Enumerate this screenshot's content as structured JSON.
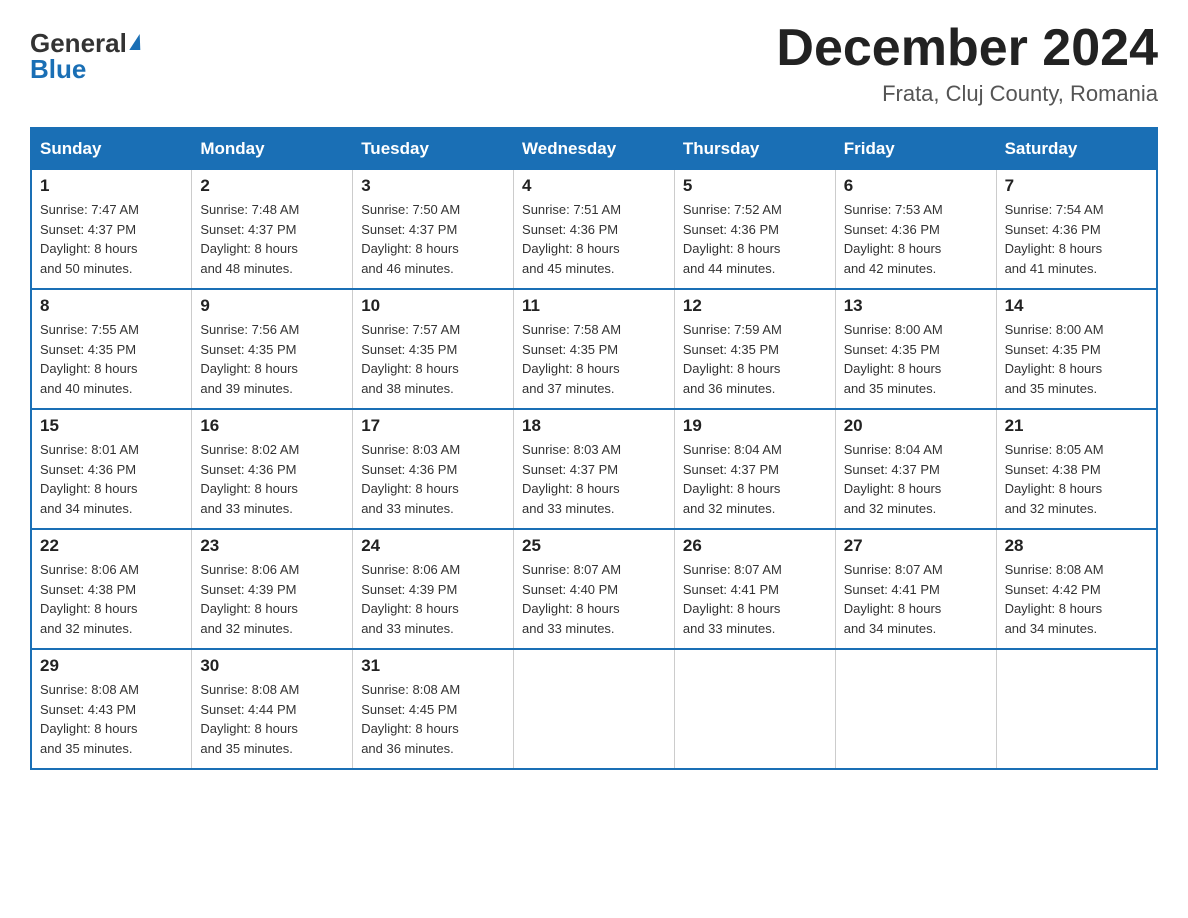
{
  "header": {
    "logo_general": "General",
    "logo_blue": "Blue",
    "month_title": "December 2024",
    "location": "Frata, Cluj County, Romania"
  },
  "days_of_week": [
    "Sunday",
    "Monday",
    "Tuesday",
    "Wednesday",
    "Thursday",
    "Friday",
    "Saturday"
  ],
  "weeks": [
    [
      {
        "day": "1",
        "sunrise": "7:47 AM",
        "sunset": "4:37 PM",
        "daylight": "8 hours and 50 minutes."
      },
      {
        "day": "2",
        "sunrise": "7:48 AM",
        "sunset": "4:37 PM",
        "daylight": "8 hours and 48 minutes."
      },
      {
        "day": "3",
        "sunrise": "7:50 AM",
        "sunset": "4:37 PM",
        "daylight": "8 hours and 46 minutes."
      },
      {
        "day": "4",
        "sunrise": "7:51 AM",
        "sunset": "4:36 PM",
        "daylight": "8 hours and 45 minutes."
      },
      {
        "day": "5",
        "sunrise": "7:52 AM",
        "sunset": "4:36 PM",
        "daylight": "8 hours and 44 minutes."
      },
      {
        "day": "6",
        "sunrise": "7:53 AM",
        "sunset": "4:36 PM",
        "daylight": "8 hours and 42 minutes."
      },
      {
        "day": "7",
        "sunrise": "7:54 AM",
        "sunset": "4:36 PM",
        "daylight": "8 hours and 41 minutes."
      }
    ],
    [
      {
        "day": "8",
        "sunrise": "7:55 AM",
        "sunset": "4:35 PM",
        "daylight": "8 hours and 40 minutes."
      },
      {
        "day": "9",
        "sunrise": "7:56 AM",
        "sunset": "4:35 PM",
        "daylight": "8 hours and 39 minutes."
      },
      {
        "day": "10",
        "sunrise": "7:57 AM",
        "sunset": "4:35 PM",
        "daylight": "8 hours and 38 minutes."
      },
      {
        "day": "11",
        "sunrise": "7:58 AM",
        "sunset": "4:35 PM",
        "daylight": "8 hours and 37 minutes."
      },
      {
        "day": "12",
        "sunrise": "7:59 AM",
        "sunset": "4:35 PM",
        "daylight": "8 hours and 36 minutes."
      },
      {
        "day": "13",
        "sunrise": "8:00 AM",
        "sunset": "4:35 PM",
        "daylight": "8 hours and 35 minutes."
      },
      {
        "day": "14",
        "sunrise": "8:00 AM",
        "sunset": "4:35 PM",
        "daylight": "8 hours and 35 minutes."
      }
    ],
    [
      {
        "day": "15",
        "sunrise": "8:01 AM",
        "sunset": "4:36 PM",
        "daylight": "8 hours and 34 minutes."
      },
      {
        "day": "16",
        "sunrise": "8:02 AM",
        "sunset": "4:36 PM",
        "daylight": "8 hours and 33 minutes."
      },
      {
        "day": "17",
        "sunrise": "8:03 AM",
        "sunset": "4:36 PM",
        "daylight": "8 hours and 33 minutes."
      },
      {
        "day": "18",
        "sunrise": "8:03 AM",
        "sunset": "4:37 PM",
        "daylight": "8 hours and 33 minutes."
      },
      {
        "day": "19",
        "sunrise": "8:04 AM",
        "sunset": "4:37 PM",
        "daylight": "8 hours and 32 minutes."
      },
      {
        "day": "20",
        "sunrise": "8:04 AM",
        "sunset": "4:37 PM",
        "daylight": "8 hours and 32 minutes."
      },
      {
        "day": "21",
        "sunrise": "8:05 AM",
        "sunset": "4:38 PM",
        "daylight": "8 hours and 32 minutes."
      }
    ],
    [
      {
        "day": "22",
        "sunrise": "8:06 AM",
        "sunset": "4:38 PM",
        "daylight": "8 hours and 32 minutes."
      },
      {
        "day": "23",
        "sunrise": "8:06 AM",
        "sunset": "4:39 PM",
        "daylight": "8 hours and 32 minutes."
      },
      {
        "day": "24",
        "sunrise": "8:06 AM",
        "sunset": "4:39 PM",
        "daylight": "8 hours and 33 minutes."
      },
      {
        "day": "25",
        "sunrise": "8:07 AM",
        "sunset": "4:40 PM",
        "daylight": "8 hours and 33 minutes."
      },
      {
        "day": "26",
        "sunrise": "8:07 AM",
        "sunset": "4:41 PM",
        "daylight": "8 hours and 33 minutes."
      },
      {
        "day": "27",
        "sunrise": "8:07 AM",
        "sunset": "4:41 PM",
        "daylight": "8 hours and 34 minutes."
      },
      {
        "day": "28",
        "sunrise": "8:08 AM",
        "sunset": "4:42 PM",
        "daylight": "8 hours and 34 minutes."
      }
    ],
    [
      {
        "day": "29",
        "sunrise": "8:08 AM",
        "sunset": "4:43 PM",
        "daylight": "8 hours and 35 minutes."
      },
      {
        "day": "30",
        "sunrise": "8:08 AM",
        "sunset": "4:44 PM",
        "daylight": "8 hours and 35 minutes."
      },
      {
        "day": "31",
        "sunrise": "8:08 AM",
        "sunset": "4:45 PM",
        "daylight": "8 hours and 36 minutes."
      },
      null,
      null,
      null,
      null
    ]
  ],
  "labels": {
    "sunrise": "Sunrise:",
    "sunset": "Sunset:",
    "daylight": "Daylight:"
  }
}
